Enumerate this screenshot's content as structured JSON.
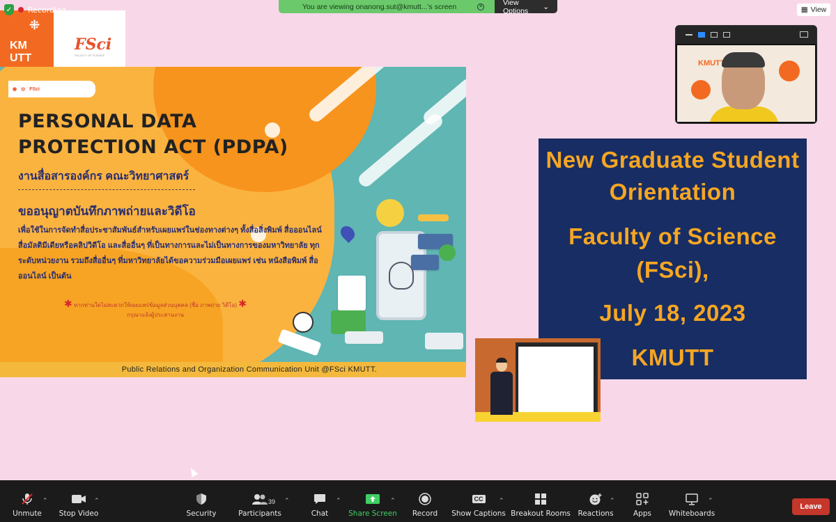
{
  "banner": {
    "recording_label": "Recording",
    "viewing_text": "You are viewing onanong.sut@kmutt...'s screen",
    "view_options_label": "View Options",
    "view_label": "View"
  },
  "logos": {
    "kmutt_line1": "KM",
    "kmutt_line2": "UTT",
    "fsci_text": "FSci",
    "fsci_sub": "FACULTY OF SCIENCE"
  },
  "pdpa_slide": {
    "top_logo_text": "FSci",
    "title_line1": "PERSONAL DATA",
    "title_line2": "PROTECTION ACT (PDPA)",
    "subtitle": "งานสื่อสารองค์กร คณะวิทยาศาสตร์",
    "heading": "ขออนุญาตบันทึกภาพถ่ายและวิดีโอ",
    "body": "เพื่อใช้ในการจัดทำสื่อประชาสัมพันธ์สำหรับเผยแพร่ในช่องทางต่างๆ ทั้งสื่อสิ่งพิมพ์ สื่อออนไลน์ สื่อมัลติมีเดียหรือคลิปวิดีโอ และสื่ออื่นๆ ที่เป็นทางการและไม่เป็นทางการของมหาวิทยาลัย ทุกระดับหน่วยงาน รวมถึงสื่ออื่นๆ ที่มหาวิทยาลัยได้ขอความร่วมมือเผยแพร่ เช่น หนังสือพิมพ์ สื่อออนไลน์ เป็นต้น",
    "note_line1": "หากท่านใดไม่สะดวกให้เผยแพร่ข้อมูลส่วนบุคคล (ชื่อ ภาพถ่าย วิดีโอ)",
    "note_line2": "กรุณาแจ้งผู้ประสานงาน",
    "footer": "Public Relations and Organization Communication Unit @FSci KMUTT."
  },
  "orientation": {
    "line1": "New Graduate  Student",
    "line2": "Orientation",
    "line3": "Faculty  of  Science",
    "line4": "(FSci),",
    "line5": "July 18, 2023",
    "line6": "KMUTT"
  },
  "video": {
    "logo_text": "KMUTT"
  },
  "toolbar": {
    "unmute": "Unmute",
    "stop_video": "Stop Video",
    "security": "Security",
    "participants": "Participants",
    "participants_count": "39",
    "chat": "Chat",
    "share_screen": "Share Screen",
    "record": "Record",
    "show_captions": "Show Captions",
    "breakout_rooms": "Breakout Rooms",
    "reactions": "Reactions",
    "apps": "Apps",
    "whiteboards": "Whiteboards",
    "leave": "Leave",
    "cc_text": "CC"
  },
  "colors": {
    "accent_green": "#3fcf64",
    "leave_red": "#c5362b",
    "slide_navy": "#182d63",
    "slide_gold": "#f5a623",
    "background_pink": "#f8d8e8"
  }
}
